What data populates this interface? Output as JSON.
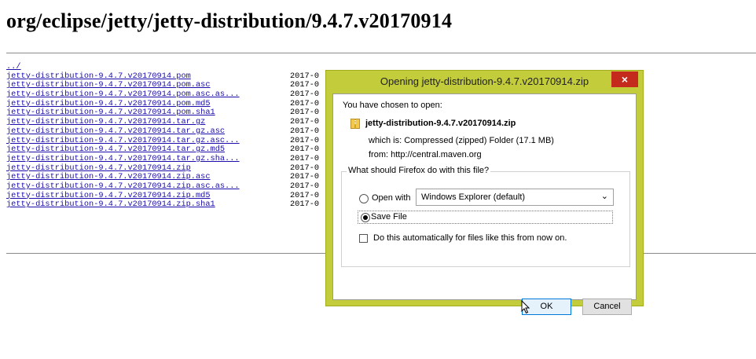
{
  "page": {
    "title": "org/eclipse/jetty/jetty-distribution/9.4.7.v20170914"
  },
  "listing": {
    "rows": [
      {
        "name": "../",
        "date": ""
      },
      {
        "name": "jetty-distribution-9.4.7.v20170914.pom",
        "date": "2017-0"
      },
      {
        "name": "jetty-distribution-9.4.7.v20170914.pom.asc",
        "date": "2017-0"
      },
      {
        "name": "jetty-distribution-9.4.7.v20170914.pom.asc.as...",
        "date": "2017-0"
      },
      {
        "name": "jetty-distribution-9.4.7.v20170914.pom.md5",
        "date": "2017-0"
      },
      {
        "name": "jetty-distribution-9.4.7.v20170914.pom.sha1",
        "date": "2017-0"
      },
      {
        "name": "jetty-distribution-9.4.7.v20170914.tar.gz",
        "date": "2017-0"
      },
      {
        "name": "jetty-distribution-9.4.7.v20170914.tar.gz.asc",
        "date": "2017-0"
      },
      {
        "name": "jetty-distribution-9.4.7.v20170914.tar.gz.asc...",
        "date": "2017-0"
      },
      {
        "name": "jetty-distribution-9.4.7.v20170914.tar.gz.md5",
        "date": "2017-0"
      },
      {
        "name": "jetty-distribution-9.4.7.v20170914.tar.gz.sha...",
        "date": "2017-0"
      },
      {
        "name": "jetty-distribution-9.4.7.v20170914.zip",
        "date": "2017-0"
      },
      {
        "name": "jetty-distribution-9.4.7.v20170914.zip.asc",
        "date": "2017-0"
      },
      {
        "name": "jetty-distribution-9.4.7.v20170914.zip.asc.as...",
        "date": "2017-0"
      },
      {
        "name": "jetty-distribution-9.4.7.v20170914.zip.md5",
        "date": "2017-0"
      },
      {
        "name": "jetty-distribution-9.4.7.v20170914.zip.sha1",
        "date": "2017-0"
      }
    ]
  },
  "dialog": {
    "title": "Opening jetty-distribution-9.4.7.v20170914.zip",
    "close_label": "×",
    "chosen_label": "You have chosen to open:",
    "file_name": "jetty-distribution-9.4.7.v20170914.zip",
    "which_is": "which is:  Compressed (zipped) Folder (17.1 MB)",
    "from": "from:  http://central.maven.org",
    "question": "What should Firefox do with this file?",
    "open_with_label": "Open with",
    "open_with_value": "Windows Explorer (default)",
    "save_file_label": "Save File",
    "auto_label": "Do this automatically for files like this from now on.",
    "ok_label": "OK",
    "cancel_label": "Cancel",
    "selected_option": "save-file"
  },
  "colors": {
    "dialog_frame": "#c3cc3b",
    "close_button": "#c42b1c",
    "link": "#1a0dab"
  }
}
